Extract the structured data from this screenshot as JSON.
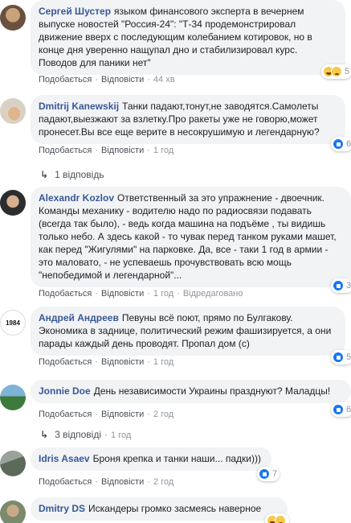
{
  "action_labels": {
    "like": "Подобається",
    "reply": "Відповісти",
    "edited": "Відредаговано"
  },
  "comments": [
    {
      "author": "Сергей Шустер",
      "text": "языком финансового эксперта в вечернем выпуске новостей \"Россия-24\": \"Т-34 продемонстрировал движение вверх с последующим колебанием котировок, но в конце дня уверенно нащупал дно и стабилизировал курс. Поводов для паники нет\"",
      "time": "44 хв",
      "reactions": {
        "types": [
          "haha",
          "sad"
        ],
        "count": "5"
      }
    },
    {
      "author": "Dmitrij Kanewskij",
      "text": "Танки падают,тонут,не заводятся.Самолеты падают,выезжают за взлетку.Про ракеты уже не говорю,может пронесет.Вы все еще верите в несокрушимую и легендарную?",
      "time": "1 год",
      "reactions": {
        "types": [
          "like"
        ],
        "count": "6"
      },
      "replies": "1 відповідь"
    },
    {
      "author": "Alexandr Kozlov",
      "text": "Ответственный за это упражнение - двоечник. Команды механику - водителю надо по радиосвязи подавать (всегда так было), - ведь когда машина на подъёме , ты видишь только небо. А здесь какой - то чувак перед танком руками машет, как перед \"Жигулями\" на парковке. Да, все - таки 1 год в армии - это маловато, - не успеваешь прочувствовать всю мощь \"непобедимой и легендарной\"...",
      "time": "1 год",
      "edited": true,
      "reactions": {
        "types": [
          "like"
        ],
        "count": "3"
      }
    },
    {
      "author": "Андрей Андреев",
      "avatar_text": "1984",
      "text": "Певуны всё поют, прямо по Булгакову. Экономика в заднице, политический режим фашизируется, а они парады каждый день проводят. Пропал дом (с)",
      "time": "1 год",
      "reactions": {
        "types": [
          "like"
        ],
        "count": "5"
      }
    },
    {
      "author": "Jonnie Doe",
      "text": "День независимости Украины празднуют? Маладцы!",
      "time": "2 год",
      "reactions": {
        "types": [
          "like"
        ],
        "count": "6"
      },
      "replies": "3 відповіді",
      "replies_time": "1 год"
    },
    {
      "author": "Idris Asaev",
      "text": "Броня крепка и танки наши... падки)))",
      "time": "2 год",
      "reactions": {
        "types": [
          "like"
        ],
        "count": "7"
      }
    },
    {
      "author": "Dmitry DS",
      "text": "Искандеры громко засмеясь наверное",
      "reactions": {
        "types": [
          "haha",
          "sad"
        ],
        "count": ""
      }
    }
  ],
  "colors": {
    "author": "#385898",
    "bubble": "#f2f3f5",
    "meta": "#90949c",
    "like_blue": "#1877f2",
    "emoji_yellow": "#f7c94a"
  }
}
